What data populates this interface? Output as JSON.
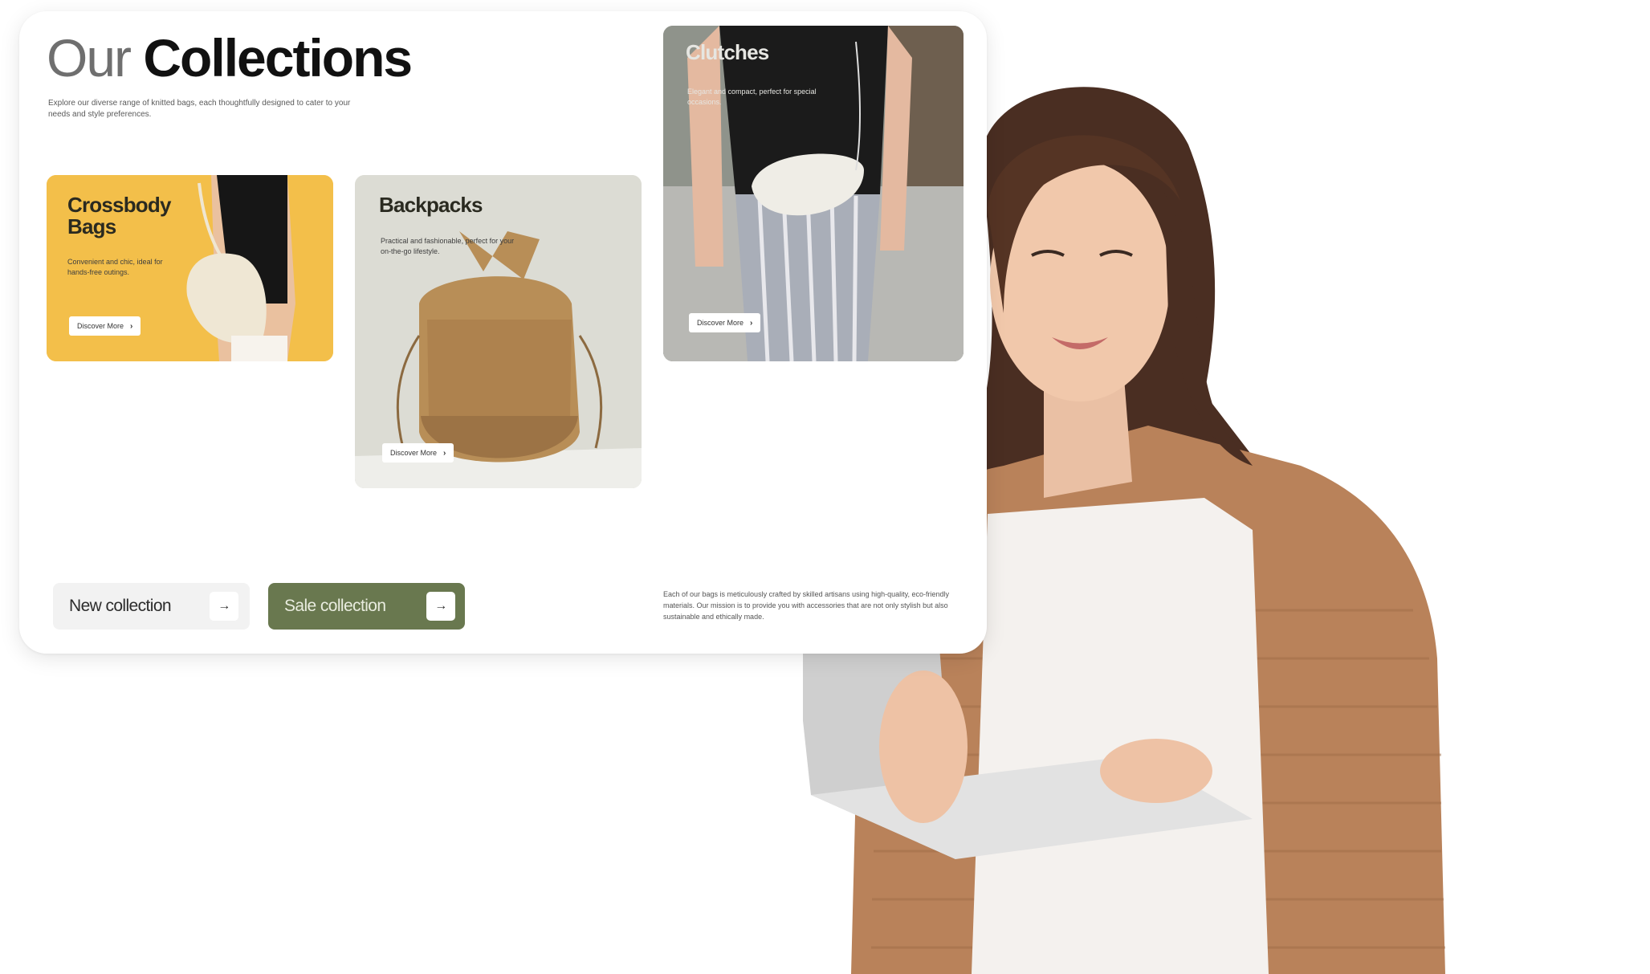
{
  "header": {
    "title_light": "Our",
    "title_bold": "Collections",
    "intro": "Explore our diverse range of knitted bags, each thoughtfully designed to cater to your needs and style preferences."
  },
  "collections": [
    {
      "title_line1": "Crossbody",
      "title_line2": "Bags",
      "description": "Convenient and chic, ideal for hands-free outings.",
      "button_label": "Discover More",
      "color": "#f3bf4a"
    },
    {
      "title_line1": "Backpacks",
      "title_line2": "",
      "description": "Practical and fashionable, perfect for your on-the-go lifestyle.",
      "button_label": "Discover More",
      "color": "#dcdcd4"
    },
    {
      "title_line1": "Clutches",
      "title_line2": "",
      "description": "Elegant and compact, perfect for special occasions.",
      "button_label": "Discover More",
      "color": "#9a9a96"
    }
  ],
  "actions": {
    "new_collection": "New collection",
    "sale_collection": "Sale collection",
    "arrow": "→"
  },
  "footer_text": "Each of our bags is meticulously crafted by skilled artisans using high-quality, eco-friendly materials. Our mission is to provide you with accessories that are not only stylish but also sustainable and ethically made.",
  "colors": {
    "accent_green": "#69784f",
    "accent_yellow": "#f3bf4a",
    "cardigan": "#b9825a"
  },
  "icons": {
    "arrow": "arrow-right-icon",
    "chevron": "chevron-right-icon"
  }
}
